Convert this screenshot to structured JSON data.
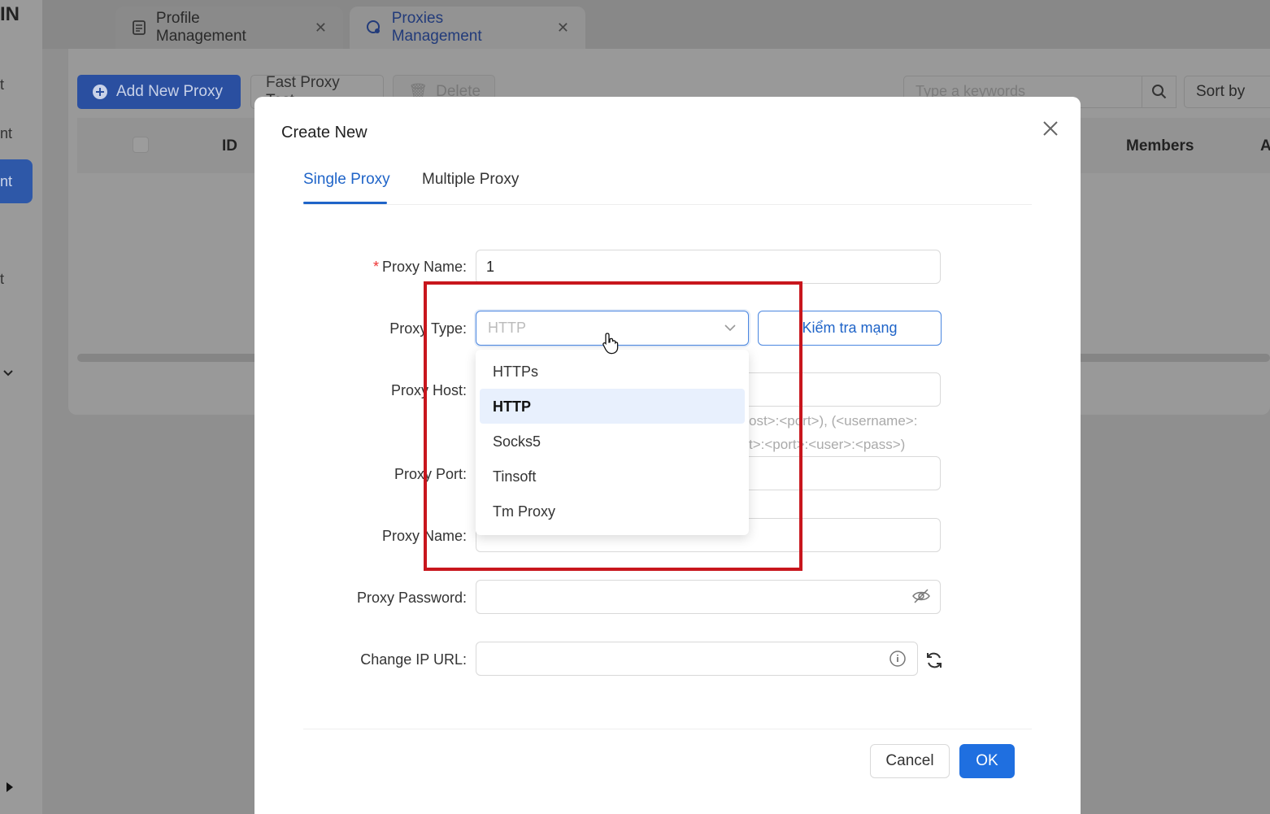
{
  "sidebar": {
    "logo": "IN",
    "items": [
      {
        "label": "t"
      },
      {
        "label": "nt"
      },
      {
        "label": "nt",
        "active": true
      },
      {
        "label": "t"
      }
    ]
  },
  "tabs": [
    {
      "label": "Profile Management",
      "icon": "document-icon"
    },
    {
      "label": "Proxies Management",
      "icon": "proxy-icon",
      "active": true
    }
  ],
  "toolbar": {
    "add_label": "Add New Proxy",
    "fast_test_label": "Fast Proxy Test",
    "delete_label": "Delete",
    "search_placeholder": "Type a keywords",
    "sort_label": "Sort by"
  },
  "table": {
    "columns": [
      "ID",
      "Members",
      "A"
    ]
  },
  "modal": {
    "title": "Create New",
    "tabs": [
      {
        "label": "Single Proxy",
        "active": true
      },
      {
        "label": "Multiple Proxy"
      }
    ],
    "fields": {
      "proxy_name": {
        "label": "Proxy Name:",
        "value": "1",
        "required": true
      },
      "proxy_type": {
        "label": "Proxy Type:",
        "value": "HTTP",
        "options": [
          "HTTPs",
          "HTTP",
          "Socks5",
          "Tinsoft",
          "Tm Proxy"
        ],
        "selected": "HTTP"
      },
      "check_network_label": "Kiểm tra mạng",
      "proxy_host": {
        "label": "Proxy Host:",
        "hint_line1": "ost>:<port>), (<username>:",
        "hint_line2": "t>:<port>:<user>:<pass>)"
      },
      "proxy_port": {
        "label": "Proxy Port:"
      },
      "proxy_username": {
        "label": "Proxy Name:"
      },
      "proxy_password": {
        "label": "Proxy Password:"
      },
      "change_ip_url": {
        "label": "Change IP URL:"
      }
    },
    "cancel_label": "Cancel",
    "ok_label": "OK"
  },
  "colors": {
    "primary": "#1f6fe0",
    "highlight_box": "#c8161d",
    "selected_option_bg": "#e8f0fd"
  }
}
